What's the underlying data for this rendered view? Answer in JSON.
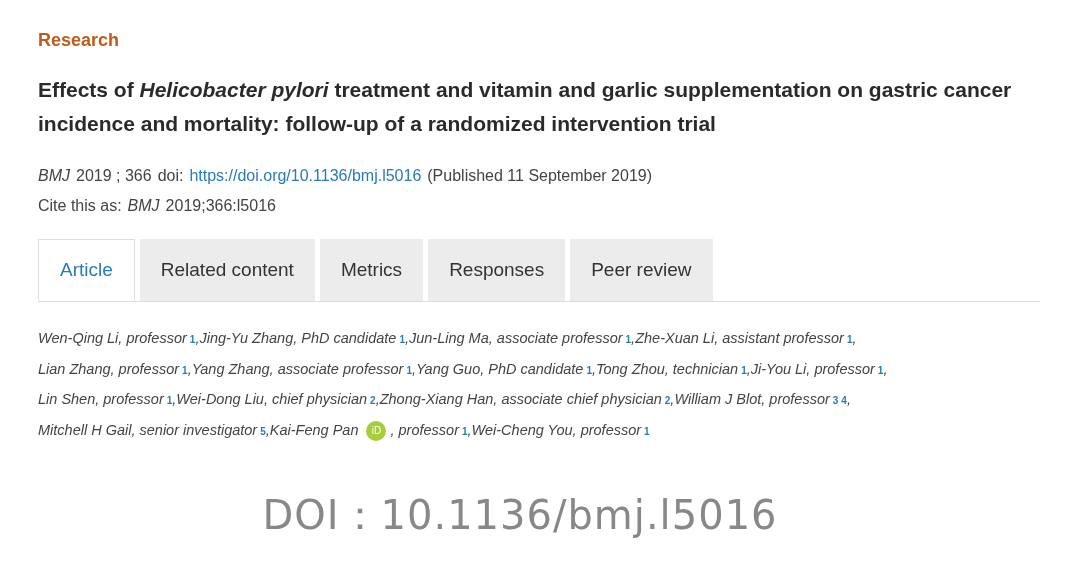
{
  "section": "Research",
  "title": "Effects of *Helicobacter pylori* treatment and vitamin and garlic supplementation on gastric cancer incidence and mortality: follow-up of a randomized intervention trial",
  "citation": {
    "journal": "BMJ",
    "volume": "2019 ; 366",
    "doi_label": "doi:",
    "doi_link": "https://doi.org/10.1136/bmj.l5016",
    "published": "(Published 11 September 2019)"
  },
  "cite_as": {
    "label": "Cite this as:",
    "journal": "BMJ",
    "reference": "2019;366:l5016"
  },
  "tabs": [
    {
      "label": "Article",
      "selected": true
    },
    {
      "label": "Related content",
      "selected": false
    },
    {
      "label": "Metrics",
      "selected": false
    },
    {
      "label": "Responses",
      "selected": false
    },
    {
      "label": "Peer review",
      "selected": false
    }
  ],
  "author_lines": [
    [
      {
        "text": "Wen-Qing Li, professor",
        "affiliations": [
          "1"
        ],
        "separator": ","
      },
      {
        "text": "Jing-Yu Zhang, PhD candidate",
        "affiliations": [
          "1"
        ],
        "separator": ","
      },
      {
        "text": "Jun-Ling Ma, associate professor",
        "affiliations": [
          "1"
        ],
        "separator": ","
      },
      {
        "text": "Zhe-Xuan Li, assistant professor",
        "affiliations": [
          "1"
        ],
        "separator": ","
      }
    ],
    [
      {
        "text": "Lian Zhang, professor",
        "affiliations": [
          "1"
        ],
        "separator": ","
      },
      {
        "text": "Yang Zhang, associate professor",
        "affiliations": [
          "1"
        ],
        "separator": ","
      },
      {
        "text": "Yang Guo, PhD candidate",
        "affiliations": [
          "1"
        ],
        "separator": ","
      },
      {
        "text": "Tong Zhou, technician",
        "affiliations": [
          "1"
        ],
        "separator": ","
      },
      {
        "text": "Ji-You Li, professor",
        "affiliations": [
          "1"
        ],
        "separator": ","
      }
    ],
    [
      {
        "text": "Lin Shen, professor",
        "affiliations": [
          "1"
        ],
        "separator": ","
      },
      {
        "text": "Wei-Dong Liu, chief physician",
        "affiliations": [
          "2"
        ],
        "separator": ","
      },
      {
        "text": "Zhong-Xiang Han, associate chief physician",
        "affiliations": [
          "2"
        ],
        "separator": ","
      },
      {
        "text": "William J Blot, professor",
        "affiliations": [
          "3",
          "4"
        ],
        "separator": ","
      }
    ],
    [
      {
        "text": "Mitchell H Gail, senior investigator",
        "affiliations": [
          "5"
        ],
        "separator": ","
      },
      {
        "text": "Kai-Feng Pan",
        "orcid": "iD",
        "role": ", professor",
        "affiliations": [
          "1"
        ],
        "separator": ","
      },
      {
        "text": "Wei-Cheng You, professor",
        "affiliations": [
          "1"
        ]
      }
    ]
  ],
  "doi_caption": "DOI：10.1136/bmj.l5016"
}
